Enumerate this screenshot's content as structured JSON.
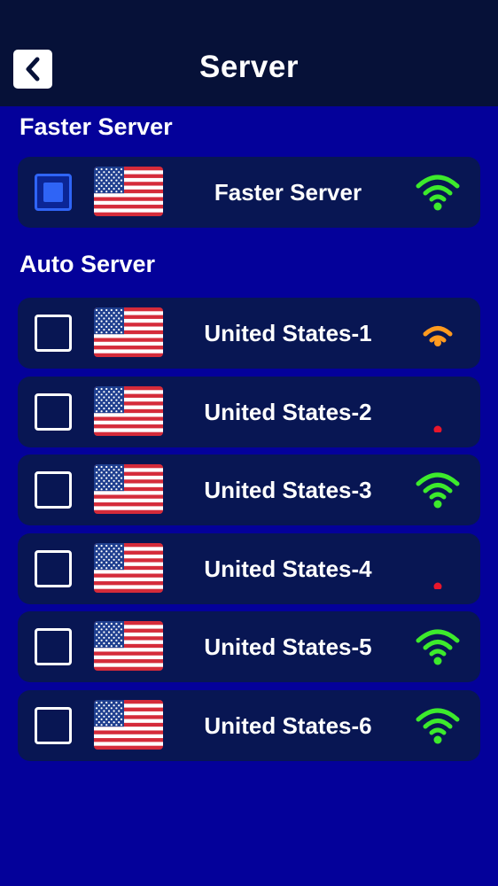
{
  "header": {
    "title": "Server",
    "back_icon": "chevron-left-icon"
  },
  "colors": {
    "background": "#04019a",
    "header_bg": "#061138",
    "row_bg": "#081653",
    "selected_accent": "#2f64f6",
    "signal_strong": "#3dea2c",
    "signal_medium": "#ff9a1f",
    "signal_weak": "#e8162b"
  },
  "faster_section": {
    "title": "Faster Server",
    "items": [
      {
        "name": "Faster Server",
        "flag": "us-flag-icon",
        "signal": "strong",
        "selected": true
      }
    ]
  },
  "auto_section": {
    "title": "Auto Server",
    "items": [
      {
        "name": "United States-1",
        "flag": "us-flag-icon",
        "signal": "medium",
        "selected": false
      },
      {
        "name": "United States-2",
        "flag": "us-flag-icon",
        "signal": "weak",
        "selected": false
      },
      {
        "name": "United States-3",
        "flag": "us-flag-icon",
        "signal": "strong",
        "selected": false
      },
      {
        "name": "United States-4",
        "flag": "us-flag-icon",
        "signal": "weak",
        "selected": false
      },
      {
        "name": "United States-5",
        "flag": "us-flag-icon",
        "signal": "strong",
        "selected": false
      },
      {
        "name": "United States-6",
        "flag": "us-flag-icon",
        "signal": "strong",
        "selected": false
      }
    ]
  }
}
